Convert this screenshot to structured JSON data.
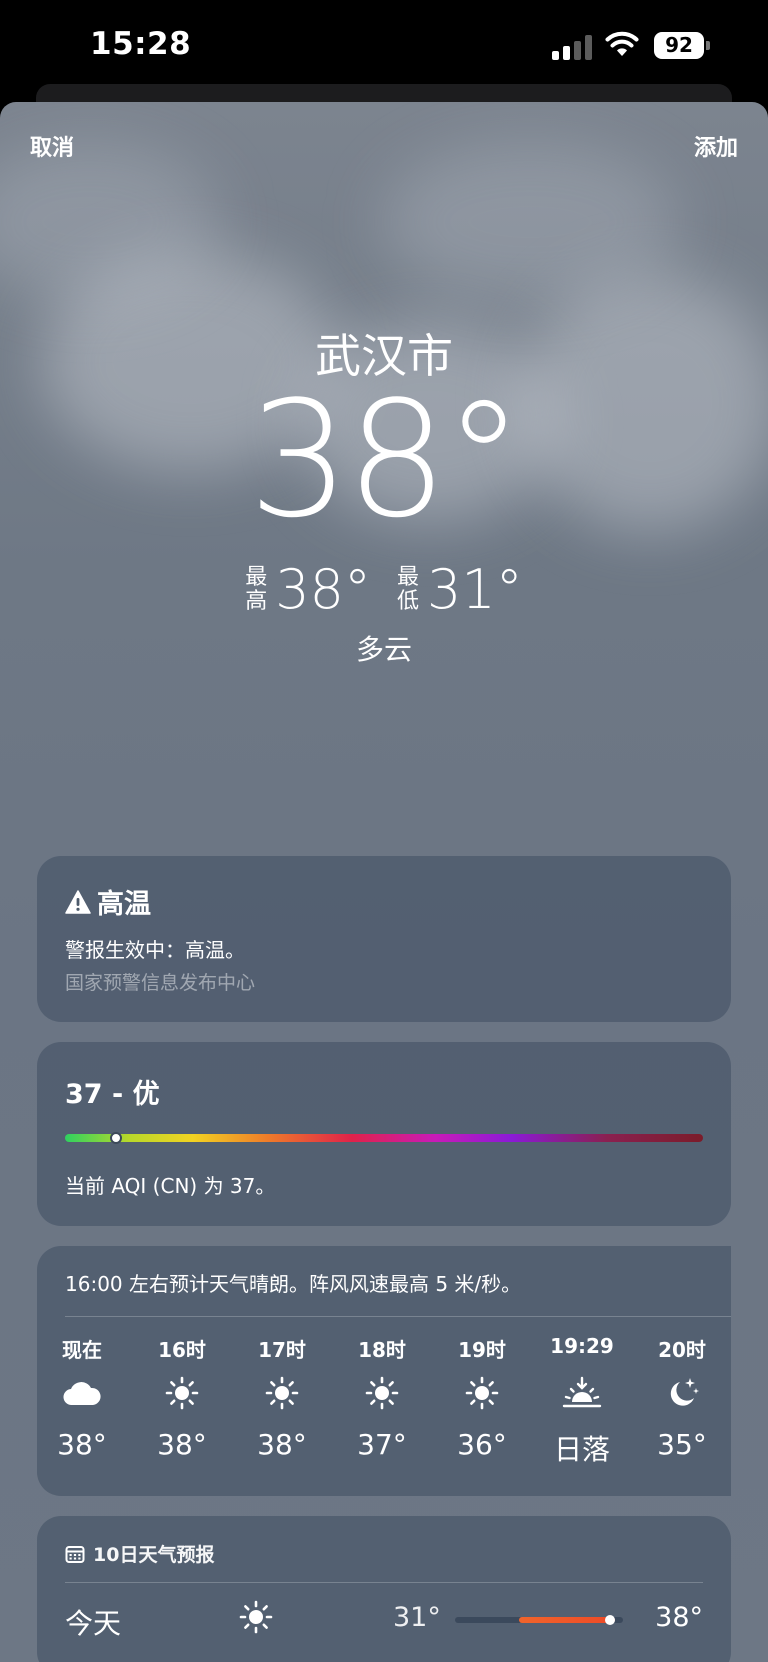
{
  "status": {
    "time": "15:28",
    "battery": "92",
    "signal_bars_active": 2
  },
  "header": {
    "cancel_label": "取消",
    "add_label": "添加"
  },
  "current": {
    "city": "武汉市",
    "temperature": "38°",
    "high_label": "最高",
    "high_value": "38°",
    "low_label": "最低",
    "low_value": "31°",
    "condition": "多云"
  },
  "alert": {
    "icon": "warning-triangle-icon",
    "title": "高温",
    "message": "警报生效中：高温。",
    "source": "国家预警信息发布中心"
  },
  "aqi": {
    "value_label": "37 - 优",
    "level_fraction": 0.08,
    "description": "当前 AQI (CN) 为 37。"
  },
  "hourly": {
    "summary": "16:00 左右预计天气晴朗。阵风风速最高 5 米/秒。",
    "items": [
      {
        "time": "现在",
        "icon": "cloud-icon",
        "temp": "38°"
      },
      {
        "time": "16时",
        "icon": "sun-icon",
        "temp": "38°"
      },
      {
        "time": "17时",
        "icon": "sun-icon",
        "temp": "38°"
      },
      {
        "time": "18时",
        "icon": "sun-icon",
        "temp": "37°"
      },
      {
        "time": "19时",
        "icon": "sun-icon",
        "temp": "36°"
      },
      {
        "time": "19:29",
        "icon": "sunset-icon",
        "temp": "日落"
      },
      {
        "time": "20时",
        "icon": "moon-stars-icon",
        "temp": "35°"
      }
    ]
  },
  "daily": {
    "header_icon": "calendar-icon",
    "header": "10日天气预报",
    "items": [
      {
        "day": "今天",
        "icon": "sun-icon",
        "low": "31°",
        "high": "38°",
        "range_start": 0.38,
        "range_end": 0.95,
        "current_marker": 0.92
      }
    ]
  },
  "colors": {
    "sheet_bg": "#6d7785",
    "card_bg": "#49586a",
    "daily_range": "#ee4a27"
  }
}
